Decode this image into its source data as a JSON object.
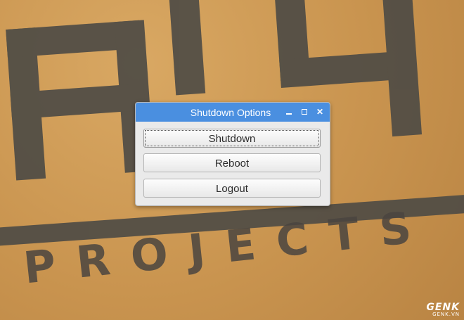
{
  "wallpaper": {
    "projects_text": "PROJECTS",
    "watermark_brand": "GENK",
    "watermark_domain": "GENK.VN"
  },
  "window": {
    "title": "Shutdown Options",
    "controls": {
      "minimize_icon": "minimize-icon",
      "maximize_icon": "maximize-icon",
      "close_icon": "close-icon",
      "close_glyph": "✕"
    },
    "buttons": [
      {
        "label": "Shutdown",
        "focused": true
      },
      {
        "label": "Reboot",
        "focused": false
      },
      {
        "label": "Logout",
        "focused": false
      }
    ]
  },
  "colors": {
    "titlebar": "#4a8fe0",
    "dialog_bg": "#eaeaea",
    "wallpaper": "#c9944f",
    "wallpaper_lettering": "#4a4540"
  }
}
